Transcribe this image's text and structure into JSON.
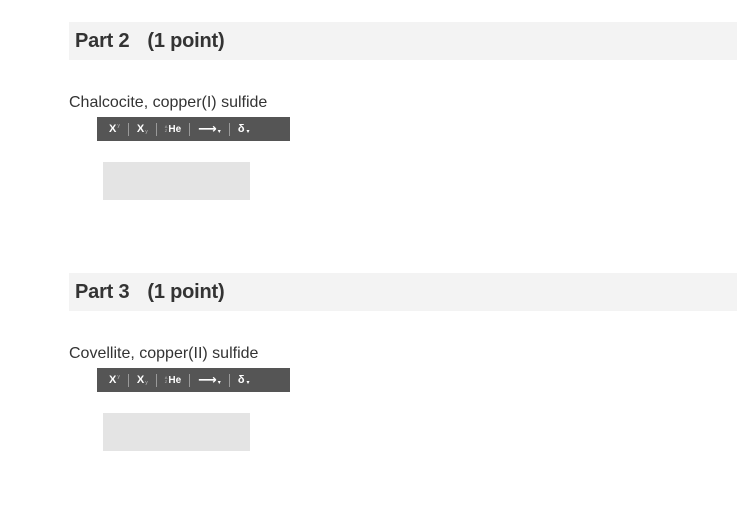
{
  "parts": [
    {
      "title": "Part 2",
      "points": "(1 point)",
      "question": "Chalcocite, copper(I) sulfide",
      "answer_value": ""
    },
    {
      "title": "Part 3",
      "points": "(1 point)",
      "question": "Covellite, copper(II) sulfide",
      "answer_value": ""
    }
  ],
  "toolbar": {
    "superscript_label": "X",
    "superscript_mark": "y",
    "subscript_label": "X",
    "subscript_mark": "y",
    "isotope_label": "He",
    "isotope_top": "A",
    "isotope_bottom": "Z",
    "arrow_label": "⟶",
    "arrow_caret": "▾",
    "delta_label": "δ",
    "delta_caret": "▾"
  },
  "colors": {
    "header_bg": "#f3f3f3",
    "toolbar_bg": "#555555",
    "answer_bg": "#e4e4e4"
  }
}
